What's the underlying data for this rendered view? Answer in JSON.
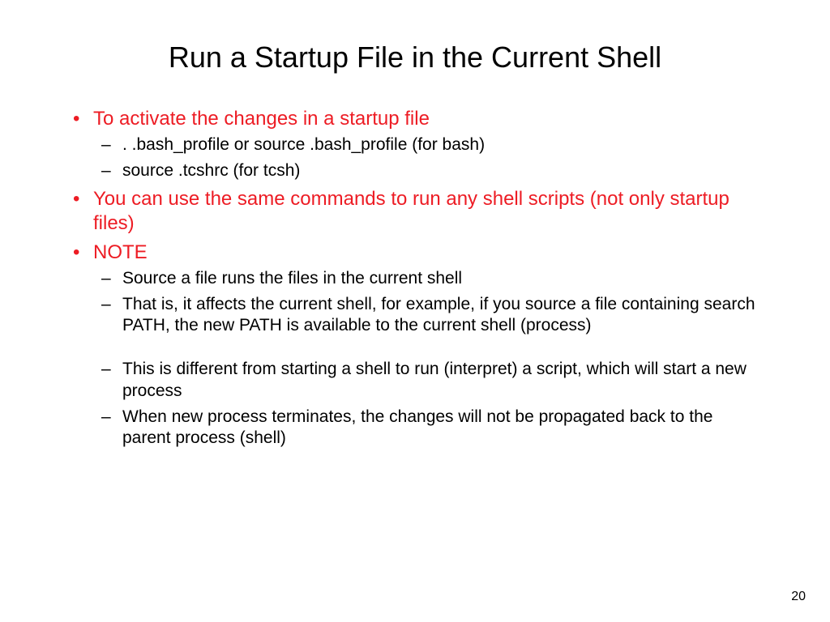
{
  "title": "Run a Startup File in the Current Shell",
  "bullets": [
    {
      "text": "To activate the changes in a startup file",
      "sub": [
        ". .bash_profile or source .bash_profile (for bash)",
        "source .tcshrc (for tcsh)"
      ]
    },
    {
      "text": "You can use the same commands to run any shell scripts (not only startup files)",
      "sub": []
    },
    {
      "text": "NOTE",
      "sub": [
        "Source a file runs the files in the current shell",
        "That is, it affects the current shell, for example, if you source a file containing search PATH, the new PATH is available to the current shell (process)",
        "__GAP__",
        "This is different from starting a shell to run (interpret) a script, which will start a new process",
        "When new process terminates, the changes will not be propagated back to the parent process (shell)"
      ]
    }
  ],
  "page_number": "20"
}
